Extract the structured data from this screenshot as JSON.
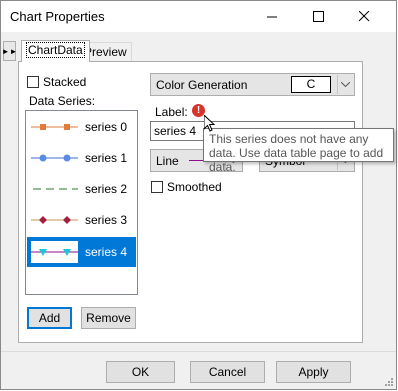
{
  "window": {
    "title": "Chart Properties"
  },
  "tabs": [
    {
      "label": "ChartData"
    },
    {
      "label": "Preview"
    }
  ],
  "stacked": {
    "label": "Stacked",
    "checked": false
  },
  "data_series": {
    "label": "Data Series:",
    "items": [
      {
        "name": "series 0",
        "color": "#e07b39",
        "marker": "square"
      },
      {
        "name": "series 1",
        "color": "#3d6fd6",
        "marker": "circle"
      },
      {
        "name": "series 2",
        "color": "#2a7a2a",
        "marker": "none"
      },
      {
        "name": "series 3",
        "color": "#a02040",
        "marker": "diamond"
      },
      {
        "name": "series 4",
        "color": "#8e0e8e",
        "marker": "triangle",
        "selected": true
      }
    ]
  },
  "buttons": {
    "add": "Add",
    "remove": "Remove",
    "ok": "OK",
    "cancel": "Cancel",
    "apply": "Apply"
  },
  "color_generation": {
    "label": "Color Generation",
    "value": "C"
  },
  "label_field": {
    "label": "Label:",
    "value": "series 4"
  },
  "line_style": {
    "value": "Line"
  },
  "symbol": {
    "value": "Symbol"
  },
  "smoothed": {
    "label": "Smoothed",
    "checked": false
  },
  "tooltip": {
    "text": "This series does not have any data. Use data table page to add data."
  },
  "colors": {
    "selection": "#0078d7",
    "warning": "#d9342b"
  }
}
